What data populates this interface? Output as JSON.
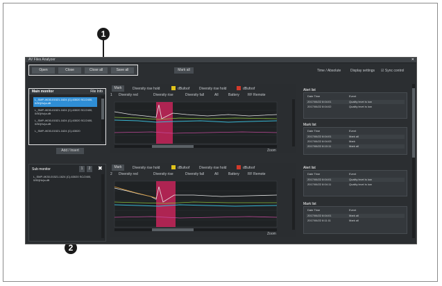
{
  "callouts": {
    "one": "1",
    "two": "2"
  },
  "window": {
    "title": "AV Files Analyzer"
  },
  "toolbar": {
    "open": "Open",
    "close": "Close",
    "close_all": "Close all",
    "save_all": "Save all"
  },
  "header": {
    "mark_all": "Mark all",
    "time_absolute": "Time / Absolute",
    "display_settings": "Display settings",
    "sync_control": "Sync control"
  },
  "main_monitor": {
    "title": "Main monitor",
    "file_label": "File Info",
    "files": [
      "L_SMP-4K30-01521-1624 (C)-63020 SC/2400, 0/50(Hz)a.dft",
      "L_SMP-4K30-01521-1624 (C)-63020 SC/2400, 0/50(Hz)a.dft",
      "L_SMP-4K30-01521-1624 (C)-63020 SC/2400, 0/50(Hz)a.dft",
      "L_SMP-4K30-01521-1624 (C)-63020"
    ],
    "add_button": "Add / Insert"
  },
  "sub_monitor": {
    "title": "Sub monitor",
    "btn_a": "1",
    "btn_b": "2",
    "file": "L_SMP-4K30-01521-1624 (C)-63020 SC/2400, 0/50(Hz)a.dft"
  },
  "chart_toolbar": {
    "mark": "Mark",
    "diversity_rise_hold": "Diversity rise hold",
    "diversity_fall_hold": "Diversity rise hold",
    "off_label": "dBufoof",
    "diversity_red": "Diversity red",
    "diversity_rise": "Diversity rise",
    "diversity_fall": "Diversity fall",
    "all": "All",
    "battery": "Battery",
    "rf_remote": "RF Remote",
    "channel_1": "1",
    "channel_2": "2"
  },
  "chart_footer": {
    "zoom": "Zoom"
  },
  "mark_list_1": {
    "title": "Alert list",
    "col_time": "Date Time",
    "col_event": "Event",
    "rows": [
      {
        "time": "2017/06/22 8:04:01",
        "event": "Quality level is low"
      },
      {
        "time": "2017/06/22 8:04:02",
        "event": "Quality level is low"
      }
    ]
  },
  "mark_list_2": {
    "title": "Mark list",
    "col_time": "Date Time",
    "col_event": "Event",
    "rows": [
      {
        "time": "2017/06/22 8:04:01",
        "event": "Mark all"
      },
      {
        "time": "2017/06/22 8:04:03",
        "event": "Mark"
      },
      {
        "time": "2017/06/22 8:10:11",
        "event": "Mark all"
      }
    ]
  },
  "mark_list_3": {
    "title": "Alert list",
    "col_time": "Date Time",
    "col_event": "Event",
    "rows": [
      {
        "time": "2017/06/22 8:04:01",
        "event": "Quality level is low"
      },
      {
        "time": "2017/06/22 8:04:11",
        "event": "Quality level is low"
      }
    ]
  },
  "mark_list_4": {
    "title": "Mark list",
    "col_time": "Date Time",
    "col_event": "Event",
    "rows": [
      {
        "time": "2017/06/22 8:04:01",
        "event": "Mark all"
      },
      {
        "time": "2017/06/22 8:11:11",
        "event": "Mark all"
      }
    ]
  },
  "colors": {
    "accent": "#2f8ed6",
    "highlight": "#c8245a",
    "yellow": "#e0c21a",
    "red": "#d43a2a"
  }
}
